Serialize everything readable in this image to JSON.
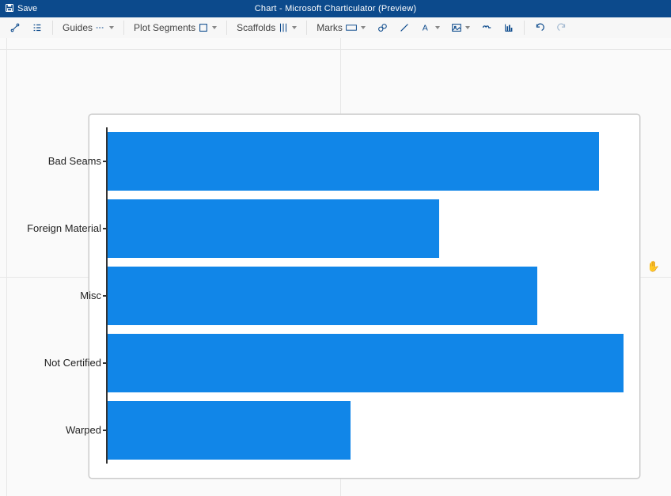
{
  "title_bar": {
    "save": "Save",
    "app_title": "Chart - Microsoft Charticulator (Preview)"
  },
  "ribbon": {
    "guides": "Guides",
    "plot_segments": "Plot Segments",
    "scaffolds": "Scaffolds",
    "marks": "Marks"
  },
  "chart_data": {
    "type": "bar",
    "orientation": "horizontal",
    "categories": [
      "Bad Seams",
      "Foreign Material",
      "Misc",
      "Not Certified",
      "Warped"
    ],
    "values": [
      95,
      64,
      83,
      100,
      47
    ],
    "xlim": [
      0,
      100
    ],
    "bar_color": "#1186e8",
    "title": "",
    "xlabel": "",
    "ylabel": ""
  }
}
